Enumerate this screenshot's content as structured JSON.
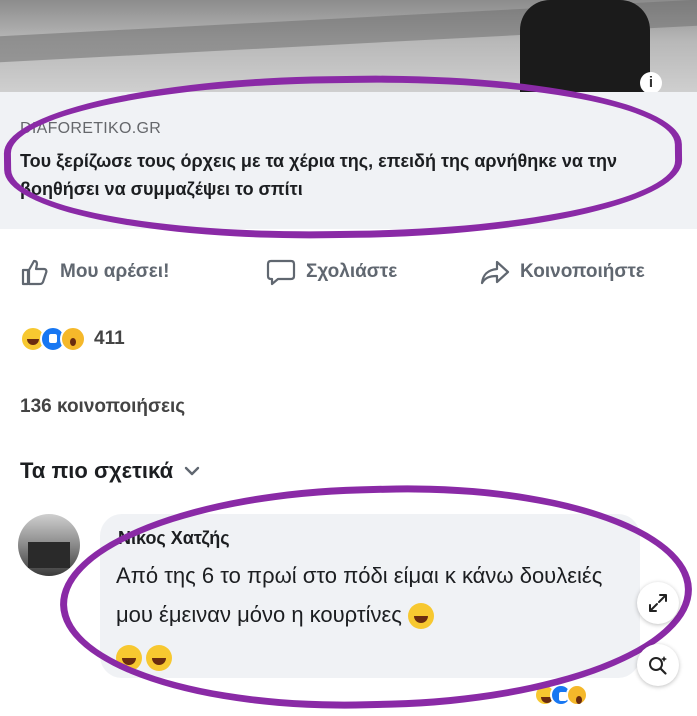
{
  "link_preview": {
    "domain": "DIAFORETIKO.GR",
    "headline": "Του ξερίζωσε τους όρχεις με τα χέρια της, επειδή της αρνήθηκε να την βοηθήσει να συμμαζέψει το σπίτι"
  },
  "actions": {
    "like_label": "Μου αρέσει!",
    "comment_label": "Σχολιάστε",
    "share_label": "Κοινοποιήστε"
  },
  "reactions": {
    "count": "411",
    "types": [
      "haha",
      "like",
      "wow"
    ]
  },
  "shares_text": "136 κοινοποιήσεις",
  "comments_filter": "Τα πιο σχετικά",
  "comment": {
    "author": "Νίκος Χατζής",
    "text": "Από της 6 το πρωί στο πόδι είμαι κ κάνω δουλειές μου έμειναν μόνο η κουρτίνες"
  },
  "colors": {
    "annotation_circle": "#8a2aa6",
    "link_card_bg": "#f0f2f5",
    "action_text": "#606770"
  },
  "icons": {
    "like": "thumbs-up-icon",
    "comment": "speech-bubble-icon",
    "share": "share-arrow-icon",
    "expand": "expand-icon",
    "visual_search": "visual-search-icon",
    "info": "info-icon",
    "filter_chevron": "chevron-down-icon"
  },
  "info_glyph": "i"
}
